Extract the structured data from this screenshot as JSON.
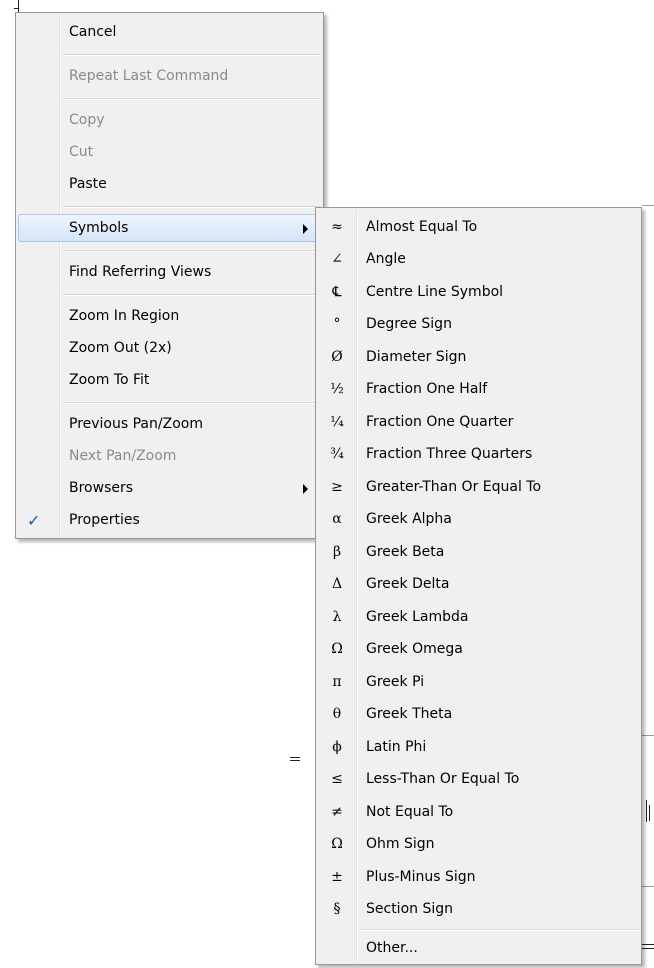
{
  "context_menu": {
    "items": [
      {
        "label": "Cancel",
        "disabled": false
      },
      {
        "label": "Repeat Last Command",
        "disabled": true
      },
      {
        "label": "Copy",
        "disabled": true
      },
      {
        "label": "Cut",
        "disabled": true
      },
      {
        "label": "Paste",
        "disabled": false
      },
      {
        "label": "Symbols",
        "disabled": false,
        "submenu": true,
        "highlighted": true
      },
      {
        "label": "Find Referring Views",
        "disabled": false
      },
      {
        "label": "Zoom In Region",
        "disabled": false
      },
      {
        "label": "Zoom Out (2x)",
        "disabled": false
      },
      {
        "label": "Zoom To Fit",
        "disabled": false
      },
      {
        "label": "Previous Pan/Zoom",
        "disabled": false
      },
      {
        "label": "Next Pan/Zoom",
        "disabled": true
      },
      {
        "label": "Browsers",
        "disabled": false,
        "submenu": true
      },
      {
        "label": "Properties",
        "disabled": false,
        "checked": true,
        "check_glyph": "✓"
      }
    ]
  },
  "symbols_menu": {
    "items": [
      {
        "symbol": "≈",
        "label": "Almost Equal To"
      },
      {
        "symbol": "∠",
        "label": "Angle"
      },
      {
        "symbol": "℄",
        "label": "Centre Line Symbol"
      },
      {
        "symbol": "°",
        "label": "Degree Sign"
      },
      {
        "symbol": "Ø",
        "label": "Diameter Sign"
      },
      {
        "symbol": "½",
        "label": "Fraction One Half"
      },
      {
        "symbol": "¼",
        "label": "Fraction One Quarter"
      },
      {
        "symbol": "¾",
        "label": "Fraction Three Quarters"
      },
      {
        "symbol": "≥",
        "label": "Greater-Than Or Equal To"
      },
      {
        "symbol": "α",
        "label": "Greek Alpha"
      },
      {
        "symbol": "β",
        "label": "Greek Beta"
      },
      {
        "symbol": "Δ",
        "label": "Greek Delta"
      },
      {
        "symbol": "λ",
        "label": "Greek Lambda"
      },
      {
        "symbol": "Ω",
        "label": "Greek Omega"
      },
      {
        "symbol": "π",
        "label": "Greek Pi"
      },
      {
        "symbol": "θ",
        "label": "Greek Theta"
      },
      {
        "symbol": "ϕ",
        "label": "Latin Phi"
      },
      {
        "symbol": "≤",
        "label": "Less-Than Or Equal To"
      },
      {
        "symbol": "≠",
        "label": "Not Equal To"
      },
      {
        "symbol": "Ω",
        "label": "Ohm Sign"
      },
      {
        "symbol": "±",
        "label": "Plus-Minus Sign"
      },
      {
        "symbol": "§",
        "label": "Section Sign"
      },
      {
        "symbol": "",
        "label": "Other..."
      }
    ]
  },
  "colors": {
    "menu_background": "#f0f0f0",
    "menu_border": "#979797",
    "highlight_border": "#a8c8f0",
    "disabled_text": "#8a8a8a",
    "check_color": "#1c5ba8"
  }
}
